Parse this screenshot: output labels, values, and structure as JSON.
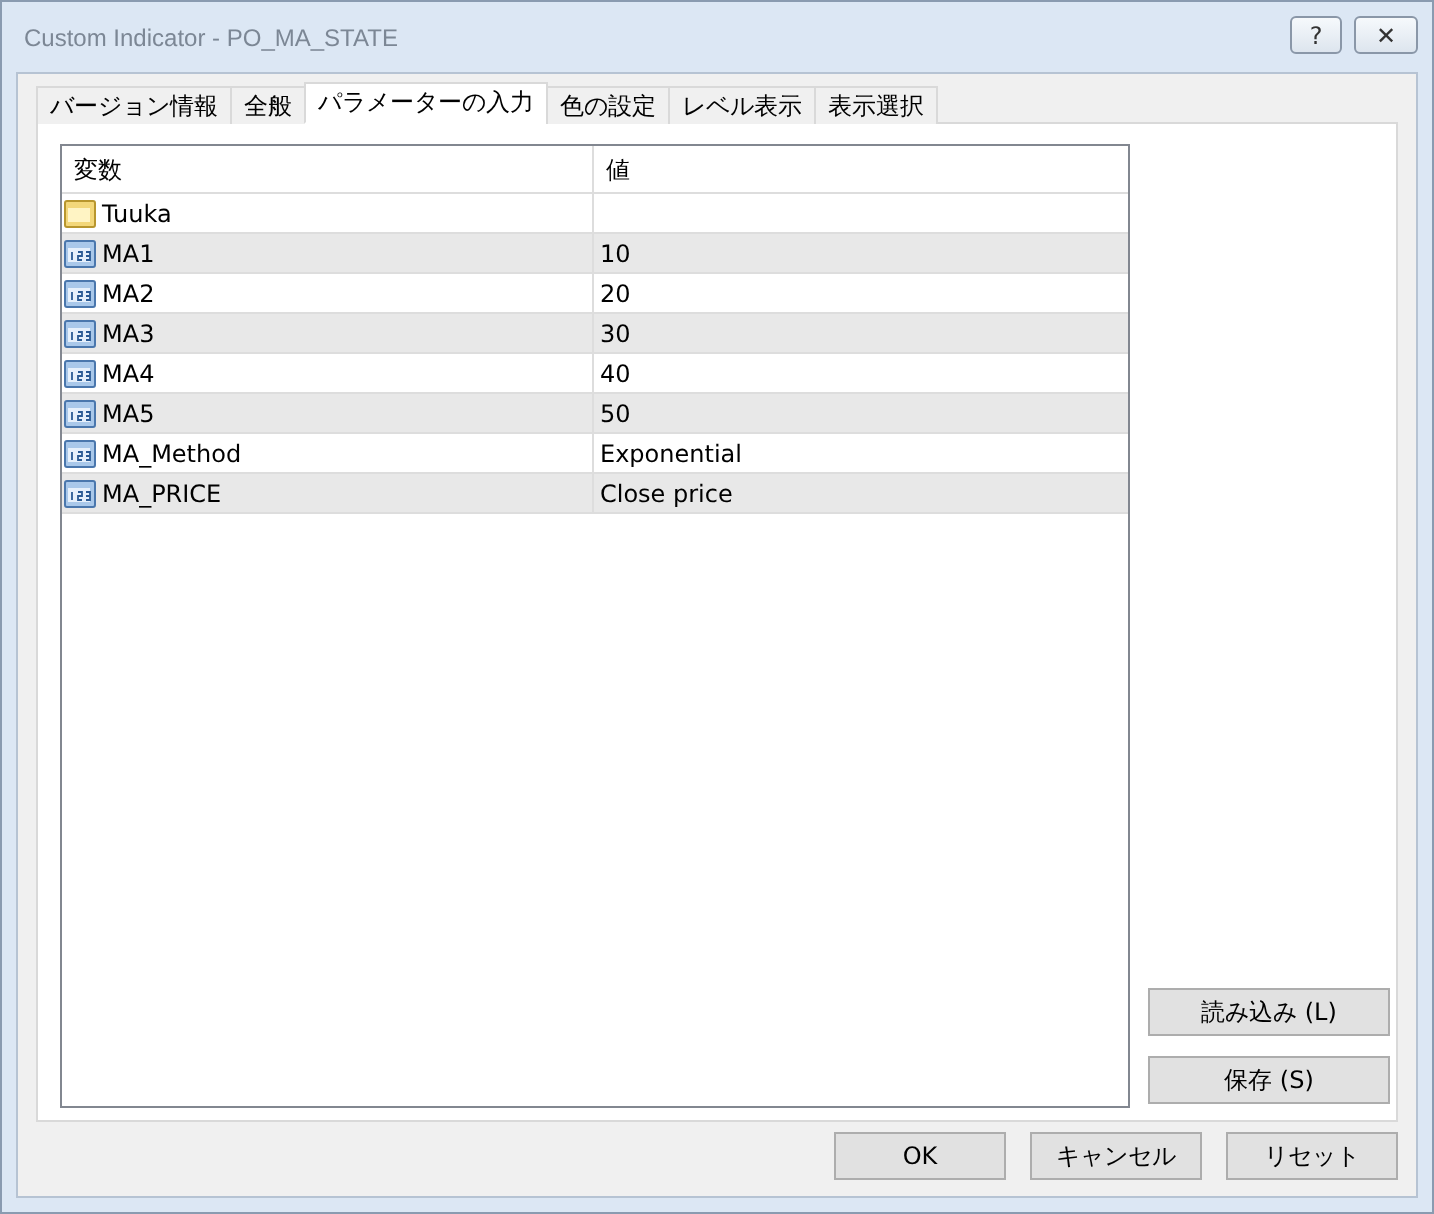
{
  "window": {
    "title": "Custom Indicator - PO_MA_STATE",
    "controls": [
      "?",
      "✕"
    ]
  },
  "tabs": [
    {
      "label": "バージョン情報",
      "selected": false
    },
    {
      "label": "全般",
      "selected": false
    },
    {
      "label": "パラメーターの入力",
      "selected": true
    },
    {
      "label": "色の設定",
      "selected": false
    },
    {
      "label": "レベル表示",
      "selected": false
    },
    {
      "label": "表示選択",
      "selected": false
    }
  ],
  "table": {
    "columns": [
      "変数",
      "値"
    ],
    "rows": [
      {
        "kind": "string",
        "name": "Tuuka",
        "value": ""
      },
      {
        "kind": "number",
        "name": "MA1",
        "value": "10"
      },
      {
        "kind": "number",
        "name": "MA2",
        "value": "20"
      },
      {
        "kind": "number",
        "name": "MA3",
        "value": "30"
      },
      {
        "kind": "number",
        "name": "MA4",
        "value": "40"
      },
      {
        "kind": "number",
        "name": "MA5",
        "value": "50"
      },
      {
        "kind": "number",
        "name": "MA_Method",
        "value": "Exponential"
      },
      {
        "kind": "number",
        "name": "MA_PRICE",
        "value": "Close price"
      }
    ]
  },
  "side_buttons": [
    "読み込み (L)",
    "保存 (S)"
  ],
  "buttons": [
    "OK",
    "キャンセル",
    "リセット"
  ]
}
